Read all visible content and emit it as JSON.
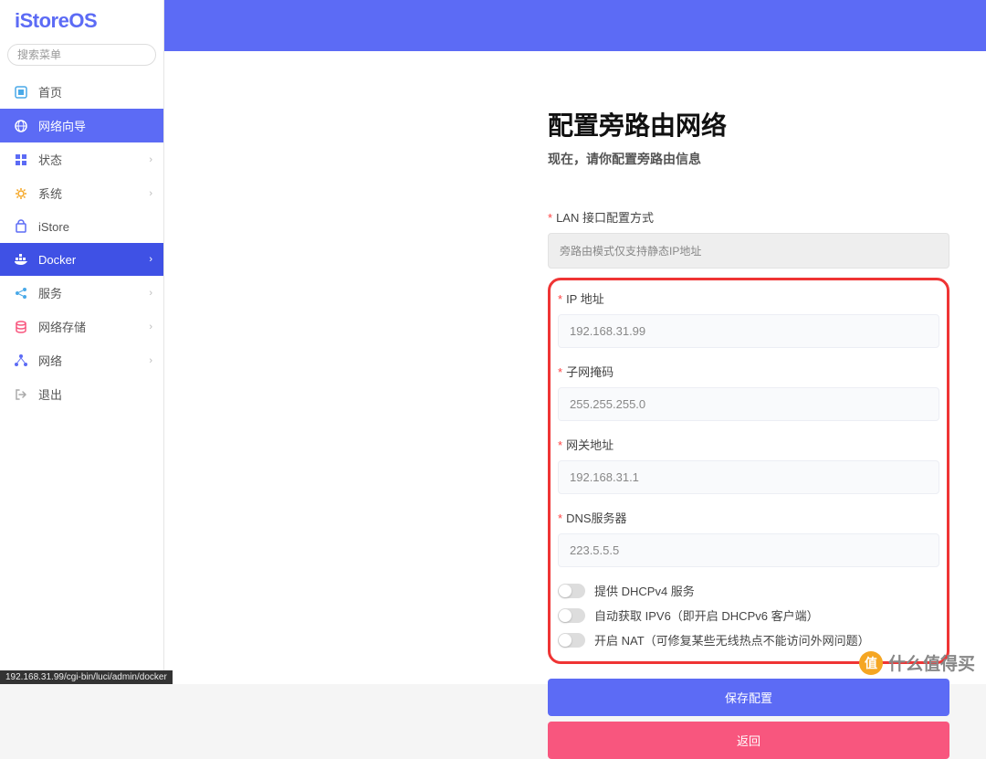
{
  "logo": "iStoreOS",
  "searchPlaceholder": "搜索菜单",
  "nav": {
    "home": "首页",
    "wizard": "网络向导",
    "status": "状态",
    "system": "系统",
    "istore": "iStore",
    "docker": "Docker",
    "services": "服务",
    "storage": "网络存储",
    "network": "网络",
    "logout": "退出"
  },
  "page": {
    "title": "配置旁路由网络",
    "subtitle": "现在，请你配置旁路由信息"
  },
  "form": {
    "lanMode": {
      "label": "LAN 接口配置方式",
      "value": "旁路由模式仅支持静态IP地址"
    },
    "ip": {
      "label": "IP 地址",
      "value": "192.168.31.99"
    },
    "mask": {
      "label": "子网掩码",
      "value": "255.255.255.0"
    },
    "gateway": {
      "label": "网关地址",
      "value": "192.168.31.1"
    },
    "dns": {
      "label": "DNS服务器",
      "value": "223.5.5.5"
    }
  },
  "toggles": {
    "dhcpv4": "提供 DHCPv4 服务",
    "ipv6": "自动获取 IPV6（即开启 DHCPv6 客户端）",
    "nat": "开启 NAT（可修复某些无线热点不能访问外网问题）"
  },
  "buttons": {
    "save": "保存配置",
    "back": "返回"
  },
  "statusUrl": "192.168.31.99/cgi-bin/luci/admin/docker",
  "watermark": "什么值得买"
}
